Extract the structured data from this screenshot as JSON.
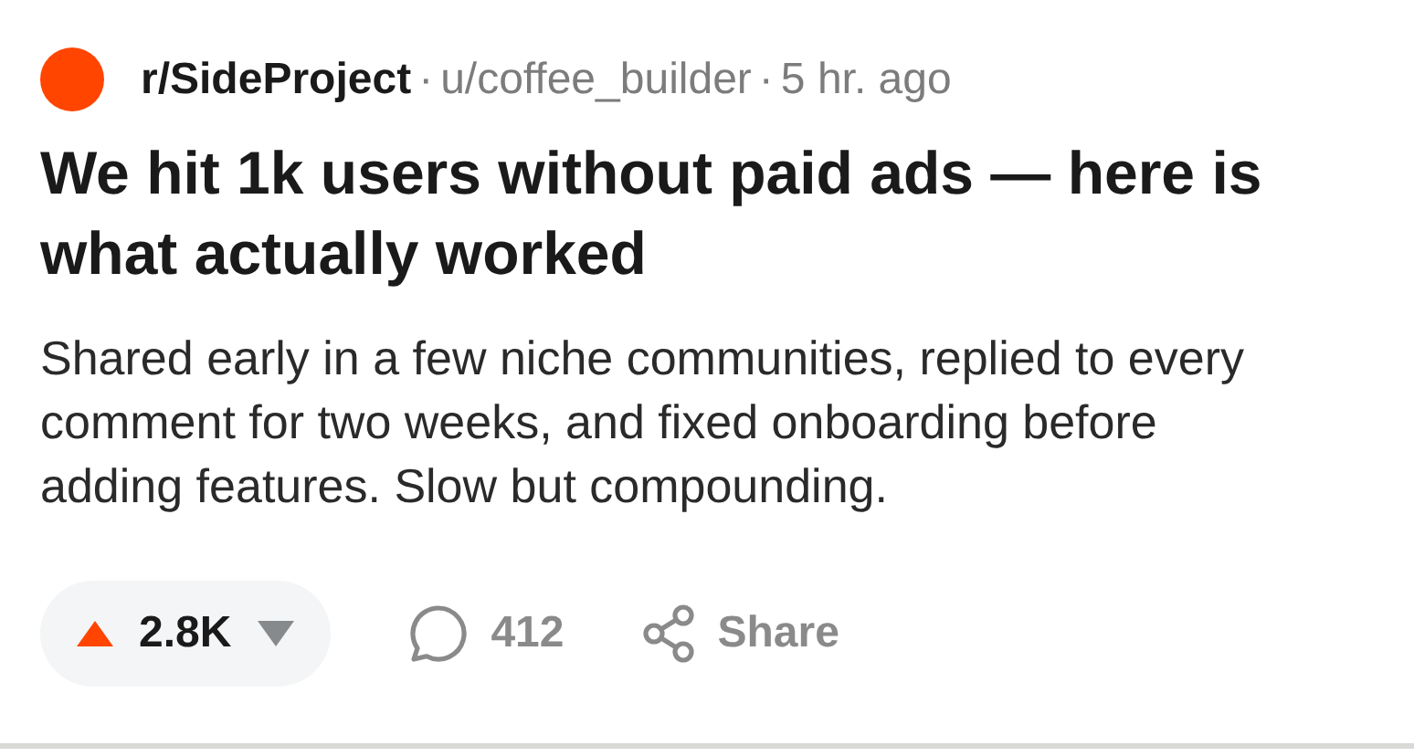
{
  "post": {
    "community": "r/SideProject",
    "author": "u/coffee_builder",
    "time": "5 hr. ago",
    "separator": "·",
    "title": "We hit 1k users without paid ads — here is what actually worked",
    "body": "Shared early in a few niche communities, replied to every comment for two weeks, and fixed onboarding before adding features. Slow but compounding."
  },
  "actions": {
    "votes": "2.8K",
    "upvoted": true,
    "downvoted": false,
    "comments": "412",
    "share": "Share"
  }
}
